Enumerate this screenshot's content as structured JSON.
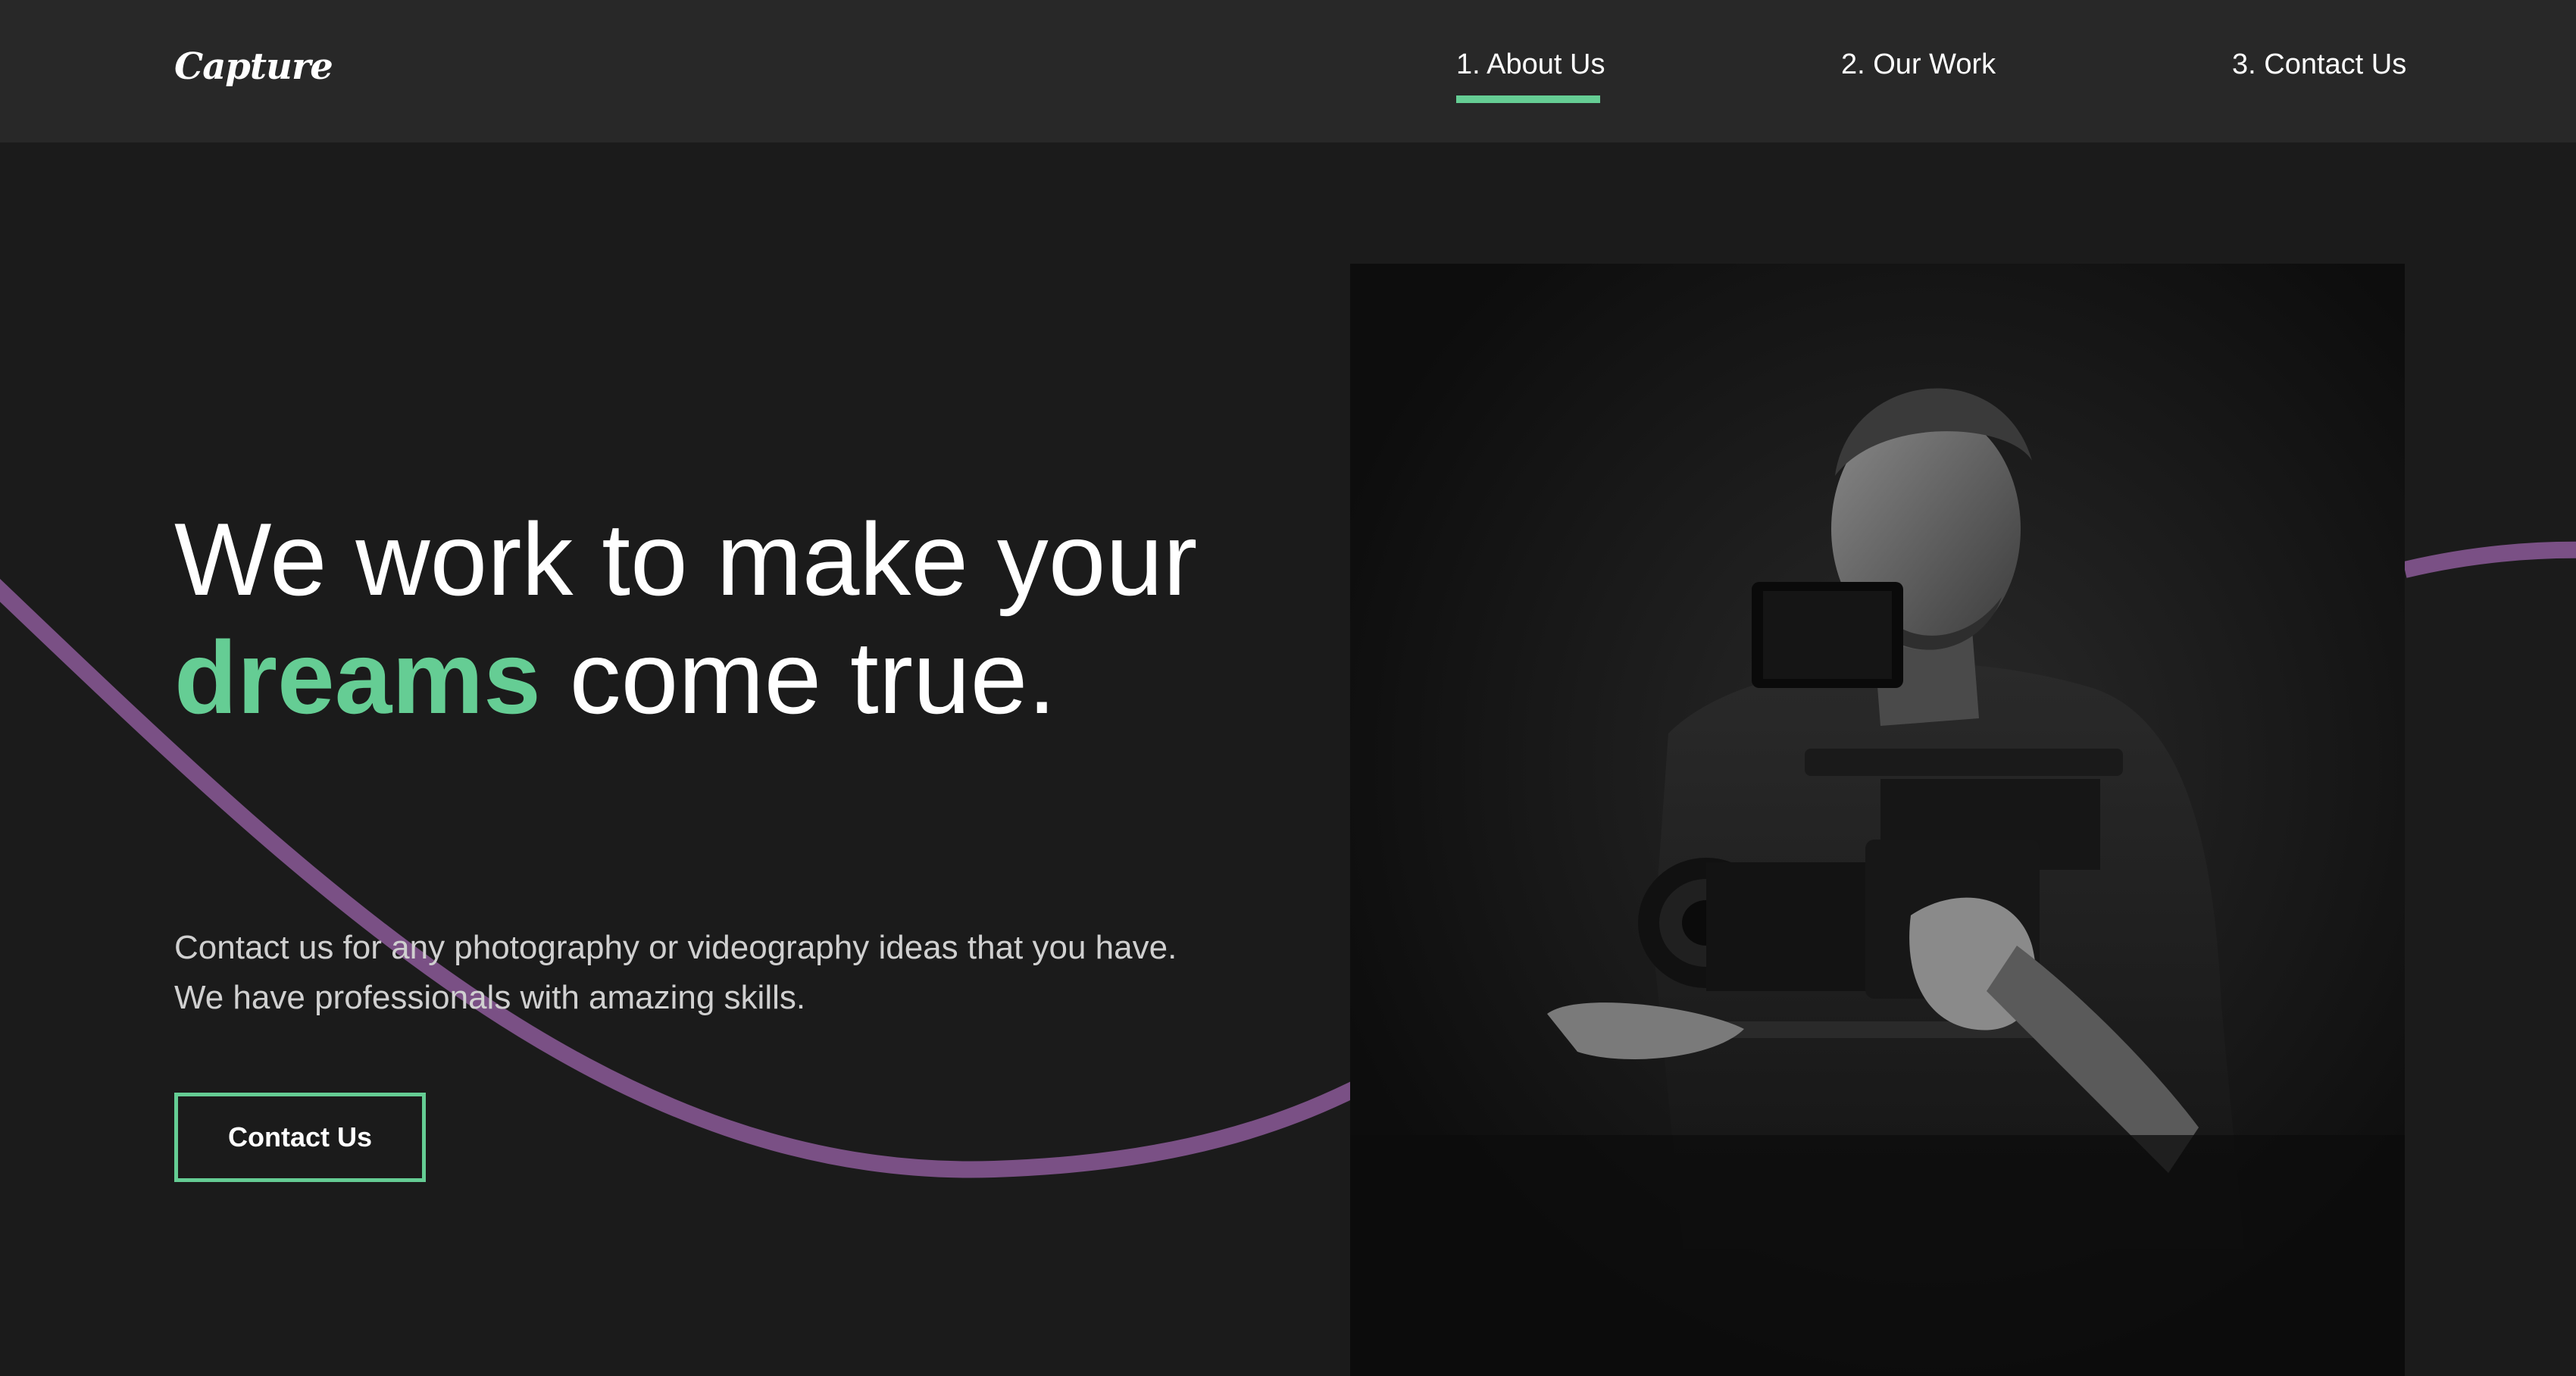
{
  "header": {
    "logo": "Capture",
    "nav": [
      {
        "label": "1. About Us",
        "active": true
      },
      {
        "label": "2. Our Work",
        "active": false
      },
      {
        "label": "3. Contact Us",
        "active": false
      }
    ]
  },
  "hero": {
    "headline_part1": "We work to make your ",
    "headline_accent": "dreams",
    "headline_part2": " come true.",
    "subtext": "Contact us for any photography or videography ideas that you have. We have professionals with amazing skills.",
    "cta_label": "Contact Us"
  },
  "colors": {
    "background": "#1b1b1b",
    "header": "#282828",
    "accent_green": "#65cd94",
    "wave_purple": "#7a5085"
  },
  "icons": [
    "wave-decoration",
    "camera-operator-photo"
  ]
}
